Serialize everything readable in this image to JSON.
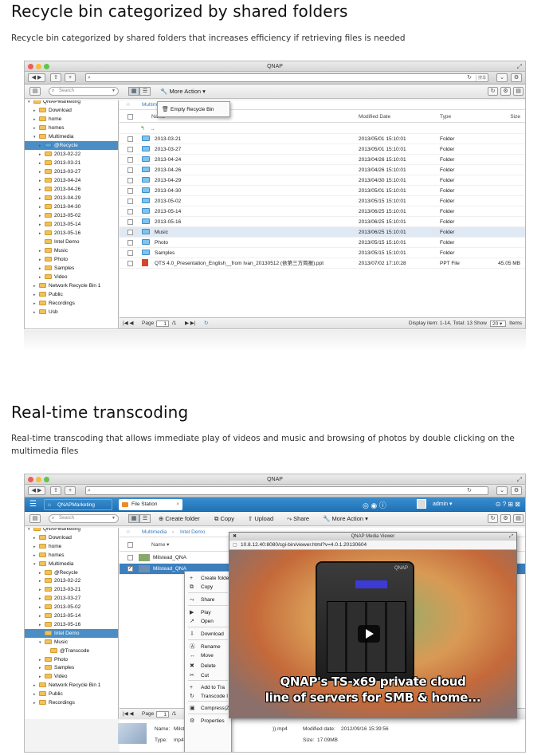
{
  "section1": {
    "title": "Recycle bin categorized by shared folders",
    "description": "Recycle bin categorized by shared folders that increases efficiency if retrieving files is needed"
  },
  "section2": {
    "title": "Real-time transcoding",
    "description": "Real-time transcoding that allows immediate play of videos and music and browsing of photos by double clicking on the multimedia files"
  },
  "window1": {
    "title": "QNAP",
    "search_btn": "搜尋",
    "search_placeholder": "Search",
    "more_action": "More Action",
    "menu_item": "Empty Recycle Bin",
    "breadcrumb": "Multim",
    "col_name": "Name",
    "col_modified": "Modified Date",
    "col_type": "Type",
    "col_size": "Size",
    "up_dir": "..",
    "tree": [
      "QNAPMarketing",
      "Download",
      "home",
      "homes",
      "Multimedia",
      "@Recycle",
      "2013-02-22",
      "2013-03-21",
      "2013-03-27",
      "2013-04-24",
      "2013-04-26",
      "2013-04-29",
      "2013-04-30",
      "2013-05-02",
      "2013-05-14",
      "2013-05-16",
      "Intel Demo",
      "Music",
      "Photo",
      "Samples",
      "Video",
      "Network Recycle Bin 1",
      "Public",
      "Recordings",
      "Usb"
    ],
    "rows": [
      {
        "name": "2013-03-21",
        "date": "2013/05/01 15:10:01",
        "type": "Folder",
        "size": ""
      },
      {
        "name": "2013-03-27",
        "date": "2013/05/01 15:10:01",
        "type": "Folder",
        "size": ""
      },
      {
        "name": "2013-04-24",
        "date": "2013/04/26 15:10:01",
        "type": "Folder",
        "size": ""
      },
      {
        "name": "2013-04-26",
        "date": "2013/04/26 15:10:01",
        "type": "Folder",
        "size": ""
      },
      {
        "name": "2013-04-29",
        "date": "2013/04/30 15:10:01",
        "type": "Folder",
        "size": ""
      },
      {
        "name": "2013-04-30",
        "date": "2013/05/01 15:10:01",
        "type": "Folder",
        "size": ""
      },
      {
        "name": "2013-05-02",
        "date": "2013/05/15 15:10:01",
        "type": "Folder",
        "size": ""
      },
      {
        "name": "2013-05-14",
        "date": "2013/06/25 15:10:01",
        "type": "Folder",
        "size": ""
      },
      {
        "name": "2013-05-16",
        "date": "2013/06/25 15:10:01",
        "type": "Folder",
        "size": ""
      },
      {
        "name": "Music",
        "date": "2013/06/25 15:10:01",
        "type": "Folder",
        "size": ""
      },
      {
        "name": "Photo",
        "date": "2013/05/15 15:10:01",
        "type": "Folder",
        "size": ""
      },
      {
        "name": "Samples",
        "date": "2013/05/15 15:10:01",
        "type": "Folder",
        "size": ""
      },
      {
        "name": "QTS 4.0_Presentation_English__from Ivan_20130512 (依第三方简报).ppt",
        "date": "2013/07/02 17:10:28",
        "type": "PPT File",
        "size": "45.05 MB"
      }
    ],
    "footer_page": "Page",
    "footer_page_value": "1",
    "footer_of": "/1",
    "footer_display": "Display item: 1-14, Total: 13",
    "footer_show": "Show",
    "footer_show_value": "20",
    "footer_items": "Items"
  },
  "window2": {
    "title": "QNAP",
    "nav_home": "QNAPMarketing",
    "nav_app": "File Station",
    "user": "admin",
    "search_placeholder": "Search",
    "btn_create": "Create folder",
    "btn_copy": "Copy",
    "btn_upload": "Upload",
    "btn_share": "Share",
    "btn_more": "More Action",
    "breadcrumb_1": "Multimedia",
    "breadcrumb_sep": "›",
    "breadcrumb_2": "Intel Demo",
    "col_name": "Name",
    "row1": "Milstead_QNA",
    "row2": "Milstead_QNA",
    "tree": [
      "QNAPMarketing",
      "Download",
      "home",
      "homes",
      "Multimedia",
      "@Recycle",
      "2013-02-22",
      "2013-03-21",
      "2013-03-27",
      "2013-05-02",
      "2013-05-14",
      "2013-05-16",
      "Intel Demo",
      "Music",
      "@Transcode",
      "Photo",
      "Samples",
      "Video",
      "Network Recycle Bin 1",
      "Public",
      "Recordings"
    ],
    "context_menu": [
      "Create folde",
      "Copy",
      "Share",
      "Play",
      "Open",
      "Download",
      "Rename",
      "Move",
      "Delete",
      "Cut",
      "Add to Tra",
      "Transcode I",
      "Compress(Zip)",
      "Properties"
    ],
    "viewer_title": "QNAP Media Viewer",
    "viewer_url": "10.8.12.40:8080/cgi-bin/viewer.html?v=4.0.1.20130604",
    "caption1": "QNAP's TS-x69 private cloud",
    "caption2": "line of servers for SMB & home...",
    "detail_name_label": "Name:",
    "detail_name_val": "Milst",
    "detail_type_label": "Type:",
    "detail_type_val": "mp4",
    "detail_file": ")).mp4",
    "detail_mod_label": "Modified date:",
    "detail_mod_val": "2012/09/16 15:39:56",
    "detail_size_label": "Size:",
    "detail_size_val": "17.09MB",
    "footer_page": "Page",
    "footer_page_value": "1",
    "footer_of": "/1"
  }
}
